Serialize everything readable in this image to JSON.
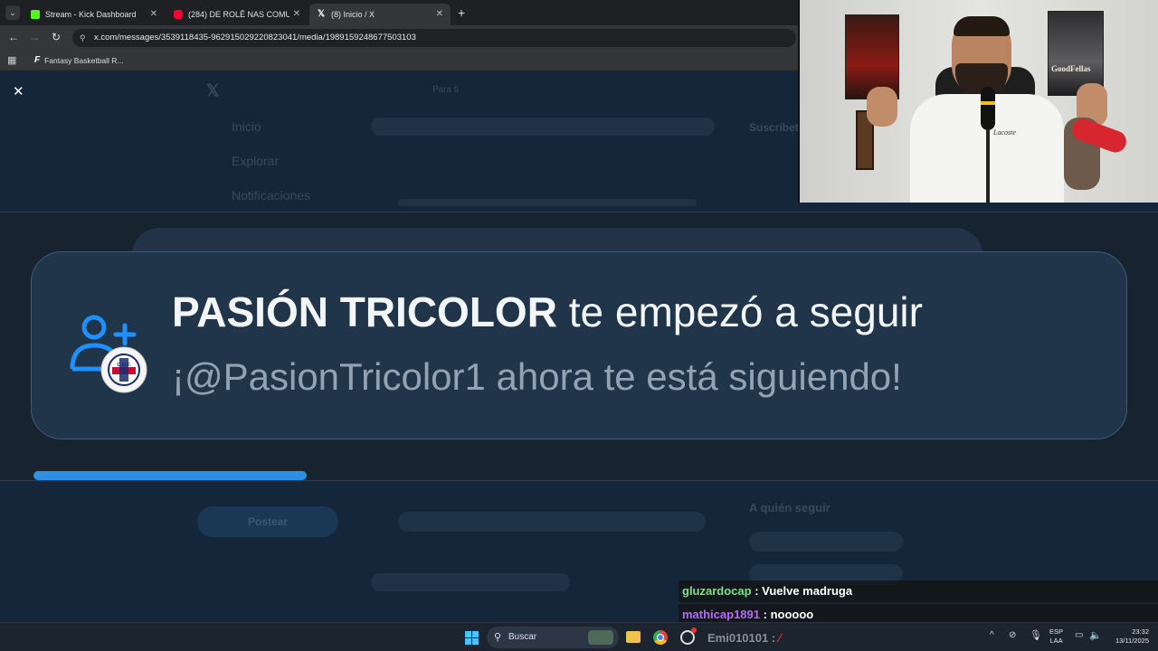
{
  "browser": {
    "tabs": [
      {
        "title": "Stream - Kick Dashboard",
        "icon": "kick-icon",
        "color": "#53fc18"
      },
      {
        "title": "(284) DE ROLÊ NAS COMUNIDA",
        "icon": "youtube-icon",
        "color": "#ff0033"
      },
      {
        "title": "(8) Inicio / X",
        "icon": "x-icon",
        "color": "#ffffff"
      }
    ],
    "url": "x.com/messages/3539118435-962915029220823041/media/1989159248677503103",
    "bookmark": "Fantasy Basketball R..."
  },
  "twitter_bg": {
    "nav": [
      "Inicio",
      "Explorar",
      "Notificaciones"
    ],
    "tab": "Para ti",
    "post_button": "Postear",
    "who_to_follow": "A quién seguir",
    "subscribe": "Suscríbete"
  },
  "notification": {
    "name": "PASIÓN TRICOLOR",
    "action": " te empezó a seguir",
    "subtitle": "¡@PasionTricolor1 ahora te está siguiendo!",
    "badge_text": "C.N.F.",
    "progress": 0.25,
    "accent_color": "#2f8fe0"
  },
  "webcam": {
    "poster_right": "GoodFellas",
    "shirt_brand": "Lacoste"
  },
  "chat": [
    {
      "user": "gluzardocap",
      "user_color": "#7ee08c",
      "message": "Vuelve madruga"
    },
    {
      "user": "mathicap1891",
      "user_color": "#b36cf5",
      "message": "nooooo"
    }
  ],
  "taskbar": {
    "search": "Buscar",
    "overlay_user": "Emi010101 :",
    "lang_top": "ESP",
    "lang_bottom": "LAA",
    "time": "23:32",
    "date": "13/11/2025"
  }
}
